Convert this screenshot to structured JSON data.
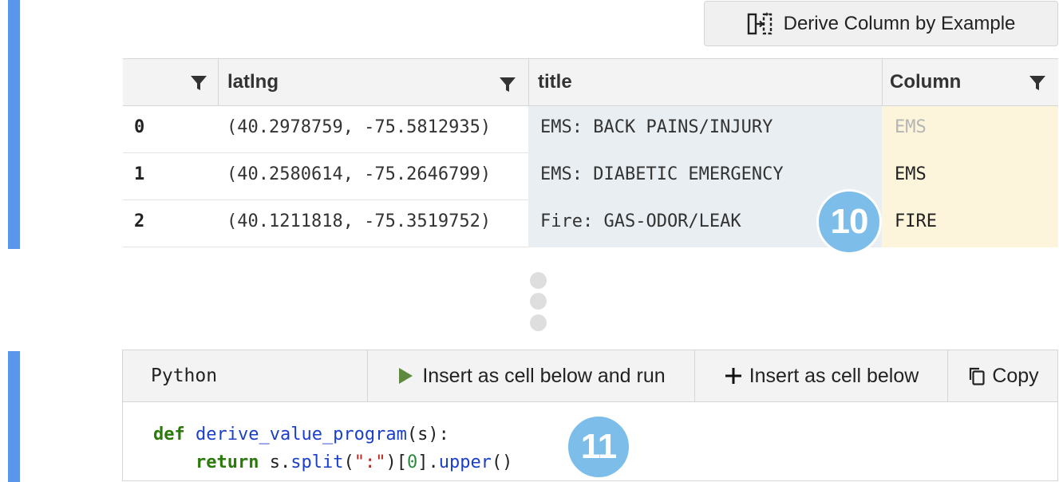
{
  "derive_button": {
    "label": "Derive Column by Example",
    "icon": "derive-column-icon"
  },
  "grid": {
    "headers": {
      "latlng": "latlng",
      "title": "title",
      "column": "Column"
    },
    "rows": [
      {
        "index": "0",
        "latlng": "(40.2978759, -75.5812935)",
        "title": "EMS: BACK PAINS/INJURY",
        "column": "EMS",
        "column_state": "suggested"
      },
      {
        "index": "1",
        "latlng": "(40.2580614, -75.2646799)",
        "title": "EMS: DIABETIC EMERGENCY",
        "column": "EMS",
        "column_state": "entered"
      },
      {
        "index": "2",
        "latlng": "(40.1211818, -75.3519752)",
        "title": "Fire: GAS-ODOR/LEAK",
        "column": "FIRE",
        "column_state": "entered"
      }
    ]
  },
  "step_badges": {
    "grid": "10",
    "code": "11"
  },
  "code_panel": {
    "language": "Python",
    "run_label": "Insert as cell below and run",
    "insert_label": "Insert as cell below",
    "copy_label": "Copy",
    "code": {
      "line1": {
        "kw": "def",
        "fn": "derive_value_program",
        "rest": "(s):"
      },
      "line2": {
        "kw": "return",
        "a": " s.",
        "split": "split",
        "b": "(",
        "str": "\":\"",
        "c": ")[",
        "num": "0",
        "d": "].",
        "upper": "upper",
        "e": "()"
      }
    }
  },
  "colors": {
    "accent_bar": "#5a96ec",
    "badge": "#7cbde9",
    "title_col_bg": "#e8eef2",
    "derived_col_bg": "#fcf5dc",
    "run_icon": "#5e8a3e"
  }
}
